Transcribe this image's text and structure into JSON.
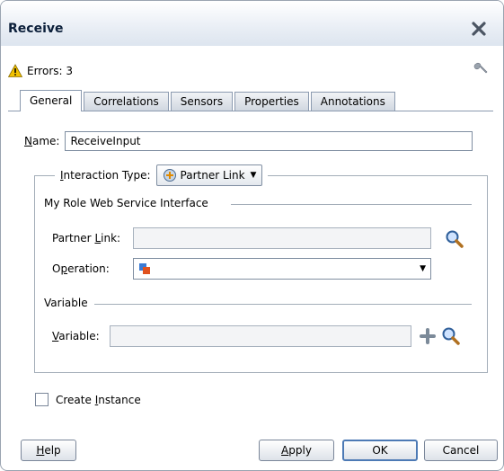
{
  "window": {
    "title": "Receive"
  },
  "status": {
    "errors_label": "Errors: 3"
  },
  "tabs": [
    {
      "label": "General",
      "active": true
    },
    {
      "label": "Correlations"
    },
    {
      "label": "Sensors"
    },
    {
      "label": "Properties"
    },
    {
      "label": "Annotations"
    }
  ],
  "general": {
    "name_label_mnemonic": "N",
    "name_label_rest": "ame:",
    "name_value": "ReceiveInput",
    "interaction_label_mnemonic": "I",
    "interaction_label_rest": "nteraction Type:",
    "interaction_value": "Partner Link",
    "role_section": "My Role Web Service Interface",
    "partner_link_label_pre": "Partner ",
    "partner_link_label_mnemonic": "L",
    "partner_link_label_post": "ink:",
    "partner_link_value": "",
    "operation_label_pre": "O",
    "operation_label_mnemonic": "p",
    "operation_label_post": "eration:",
    "operation_value": "",
    "variable_section": "Variable",
    "variable_label_mnemonic": "V",
    "variable_label_rest": "ariable:",
    "variable_value": "",
    "create_instance_pre": "Create ",
    "create_instance_mnemonic": "I",
    "create_instance_post": "nstance",
    "create_instance_checked": false
  },
  "buttons": {
    "help_mnemonic": "H",
    "help_rest": "elp",
    "apply_mnemonic": "A",
    "apply_rest": "pply",
    "ok": "OK",
    "cancel": "Cancel"
  },
  "colors": {
    "accent": "#4d7ab5",
    "warning": "#f2c200",
    "title": "#0b1f3a"
  }
}
